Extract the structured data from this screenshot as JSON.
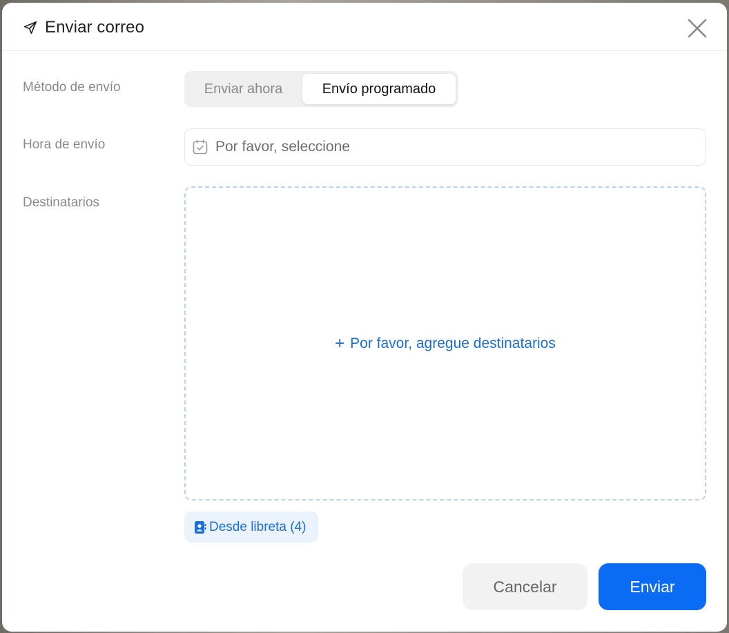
{
  "dialog": {
    "title": "Enviar correo",
    "icons": {
      "title_icon": "send-icon",
      "close": "close-icon"
    }
  },
  "form": {
    "method": {
      "label": "Método de envío",
      "options": [
        "Enviar ahora",
        "Envío programado"
      ],
      "selected": "Envío programado"
    },
    "time": {
      "label": "Hora de envío",
      "placeholder": "Por favor, seleccione",
      "icon": "calendar-icon"
    },
    "recipients": {
      "label": "Destinatarios",
      "add_text": "Por favor, agregue destinatarios",
      "add_icon": "plus-icon"
    },
    "address_book": {
      "label": "Desde libreta (4)",
      "icon": "contact-book-icon"
    }
  },
  "footer": {
    "cancel_label": "Cancelar",
    "send_label": "Enviar"
  },
  "colors": {
    "primary": "#0a6cf5",
    "link": "#1a6fd1",
    "dashed_border": "#b7d4ee",
    "label_gray": "#8a8a8a"
  }
}
